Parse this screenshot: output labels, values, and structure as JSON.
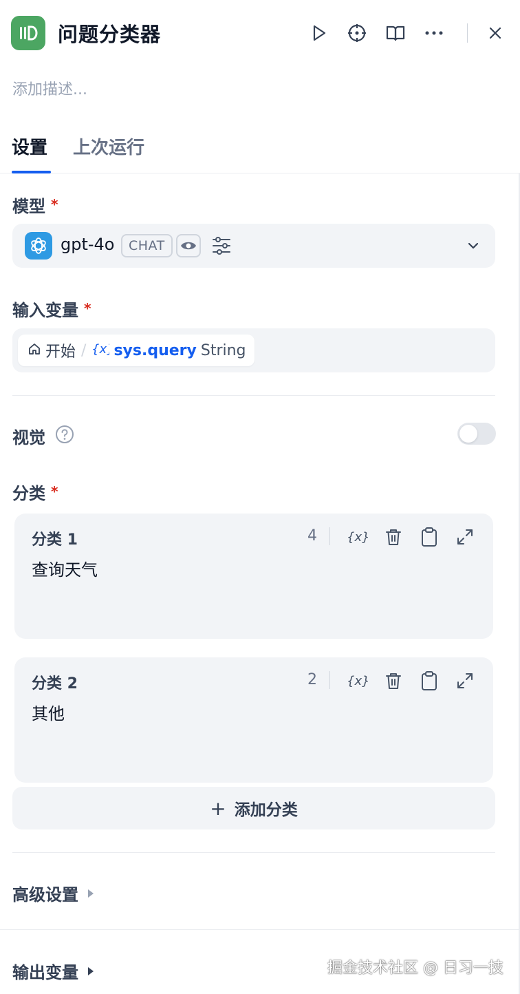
{
  "header": {
    "title": "问题分类器",
    "description_placeholder": "添加描述...",
    "icons": {
      "app": "classifier-icon",
      "run": "play-icon",
      "locate": "crosshair-icon",
      "docs": "book-icon",
      "more": "more-icon",
      "close": "close-icon"
    }
  },
  "tabs": [
    {
      "label": "设置",
      "active": true
    },
    {
      "label": "上次运行",
      "active": false
    }
  ],
  "model": {
    "label": "模型",
    "required_mark": "*",
    "name": "gpt-4o",
    "mode_badge": "CHAT"
  },
  "input_variable": {
    "label": "输入变量",
    "required_mark": "*",
    "node": "开始",
    "separator": "/",
    "variable": "sys.query",
    "type": "String"
  },
  "vision": {
    "label": "视觉",
    "enabled": false
  },
  "classes": {
    "label": "分类",
    "required_mark": "*",
    "items": [
      {
        "title": "分类 1",
        "text": "查询天气",
        "count": "4"
      },
      {
        "title": "分类 2",
        "text": "其他",
        "count": "2"
      }
    ],
    "add_label": "添加分类",
    "add_symbol": "+"
  },
  "advanced": {
    "label": "高级设置"
  },
  "output": {
    "label": "输出变量"
  },
  "watermark": "掘金技术社区 @ 日习一技",
  "colors": {
    "accent": "#155eef",
    "app_icon": "#4ca662",
    "model_icon": "#2e9ae3",
    "required": "#d92d20"
  }
}
